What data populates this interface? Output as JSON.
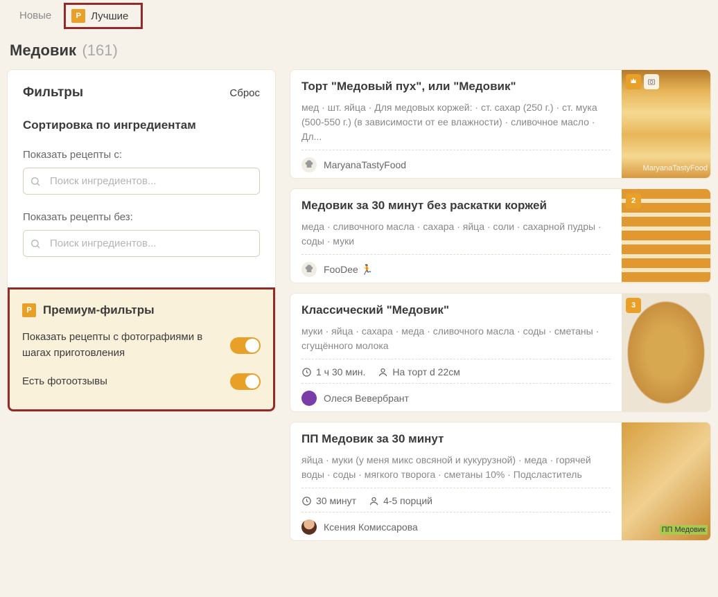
{
  "tabs": {
    "new": "Новые",
    "best": "Лучшие"
  },
  "page": {
    "title": "Медовик",
    "count": "(161)"
  },
  "filters": {
    "title": "Фильтры",
    "reset": "Сброс",
    "sort_title": "Сортировка по ингредиентам",
    "show_with_label": "Показать рецепты с:",
    "show_without_label": "Показать рецепты без:",
    "search_placeholder": "Поиск ингредиентов..."
  },
  "premium": {
    "title": "Премиум-фильтры",
    "with_photos": "Показать рецепты с фотографиями в шагах приготовления",
    "has_reviews": "Есть фотоотзывы"
  },
  "recipes": [
    {
      "title": "Торт \"Медовый пух\", или \"Медовик\"",
      "ingredients": "мед · шт. яйца · Для медовых коржей: · ст. сахар (250 г.) · ст. мука (500-550 г.) (в зависимости от ее влажности) · сливочное масло · Дл...",
      "author": "MaryanaTastyFood",
      "badge": "1",
      "watermark": "MaryanaTastyFood"
    },
    {
      "title": "Медовик за 30 минут без раскатки коржей",
      "ingredients": "меда · сливочного масла · сахара · яйца · соли · сахарной пудры · соды · муки",
      "author": "FooDee 🏃",
      "badge": "2"
    },
    {
      "title": "Классический \"Медовик\"",
      "ingredients": "муки · яйца · сахара · меда · сливочного масла · соды · сметаны · сгущённого молока",
      "time": "1 ч 30 мин.",
      "servings": "На торт d 22см",
      "author": "Олеся Вевербрант",
      "badge": "3"
    },
    {
      "title": "ПП Медовик за 30 минут",
      "ingredients": "яйца · муки (у меня микс овсяной и кукурузной) · меда · горячей воды · соды · мягкого творога · сметаны 10% · Подсластитель",
      "time": "30 минут",
      "servings": "4-5 порций",
      "author": "Ксения Комиссарова",
      "watermark": "ПП Медовик"
    }
  ]
}
